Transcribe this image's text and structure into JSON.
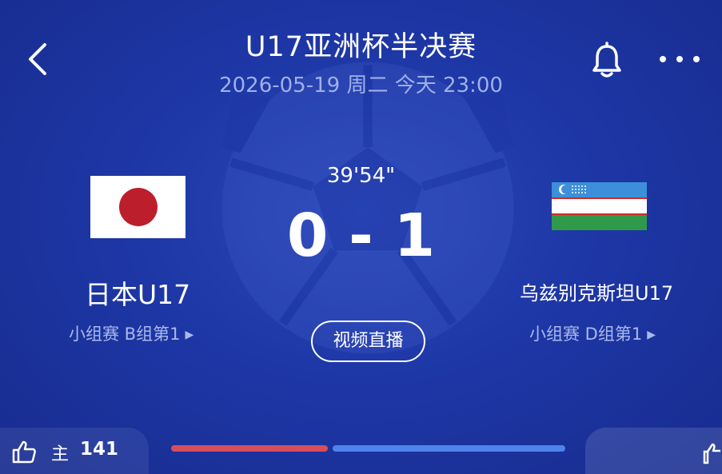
{
  "header": {
    "back_icon": "chevron-left-icon",
    "title": "U17亚洲杯半决赛",
    "subtitle": "2026-05-19 周二 今天 23:00",
    "bell_icon": "bell-icon",
    "more_icon": "more-dots-icon"
  },
  "match": {
    "time": "39'54\"",
    "score": "0 - 1",
    "live_button": "视频直播"
  },
  "home_team": {
    "name": "日本U17",
    "group": "小组赛 B组第1",
    "flag": "japan-flag",
    "flag_colors": {
      "field": "#ffffff",
      "sun": "#bc1f2b"
    }
  },
  "away_team": {
    "name": "乌兹别克斯坦U17",
    "group": "小组赛 D组第1",
    "flag": "uzbekistan-flag",
    "flag_colors": {
      "top": "#3c8fd8",
      "middle": "#ffffff",
      "bottom": "#2f9a4a",
      "stripe": "#cc2b2b"
    }
  },
  "footer": {
    "like_icon": "thumbs-up-icon",
    "like_label": "主",
    "like_count": "141",
    "colors": {
      "home_bar": "#d54e5e",
      "away_bar": "#4f83ec"
    }
  }
}
